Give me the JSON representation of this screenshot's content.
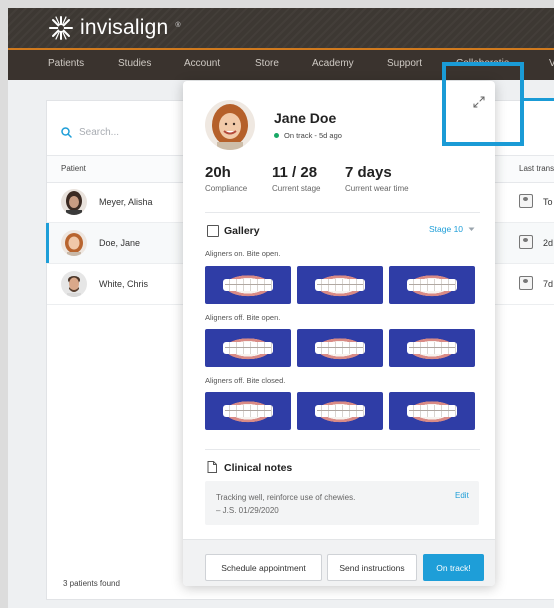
{
  "app": {
    "logo_text": "invisalign",
    "logo_mark": "®"
  },
  "nav": {
    "items": [
      "Patients",
      "Studies",
      "Account",
      "Store",
      "Academy",
      "Support",
      "Collaboratio",
      "V"
    ]
  },
  "search": {
    "placeholder": "Search..."
  },
  "list": {
    "headers": {
      "patient": "Patient",
      "last": "Last trans"
    },
    "rows": [
      {
        "name": "Meyer, Alisha",
        "last": "To"
      },
      {
        "name": "Doe, Jane",
        "last": "2d"
      },
      {
        "name": "White, Chris",
        "last": "7d"
      }
    ],
    "footer": "3 patients found",
    "selected_row": "Doe, Jane"
  },
  "popup": {
    "name": "Jane Doe",
    "status": "On track - 5d ago",
    "status_color": "#18a866",
    "stats": [
      {
        "value": "20h",
        "label": "Compliance"
      },
      {
        "value": "11 / 28",
        "label": "Current stage"
      },
      {
        "value": "7 days",
        "label": "Current wear time"
      }
    ],
    "gallery": {
      "title": "Gallery",
      "stage": "Stage 10",
      "groups": [
        "Aligners on. Bite open.",
        "Aligners off. Bite open.",
        "Aligners off. Bite closed."
      ]
    },
    "notes": {
      "title": "Clinical notes",
      "text_line1": "Tracking well, reinforce use of chewies.",
      "text_line2": "– J.S. 01/29/2020",
      "edit": "Edit"
    },
    "buttons": {
      "schedule": "Schedule appointment",
      "send": "Send instructions",
      "on_track": "On track!"
    }
  },
  "colors": {
    "accent": "#1e9ed8",
    "topbar": "#3d3833",
    "nav_underline": "#d07a1e",
    "highlight": "#1a9bd6"
  }
}
